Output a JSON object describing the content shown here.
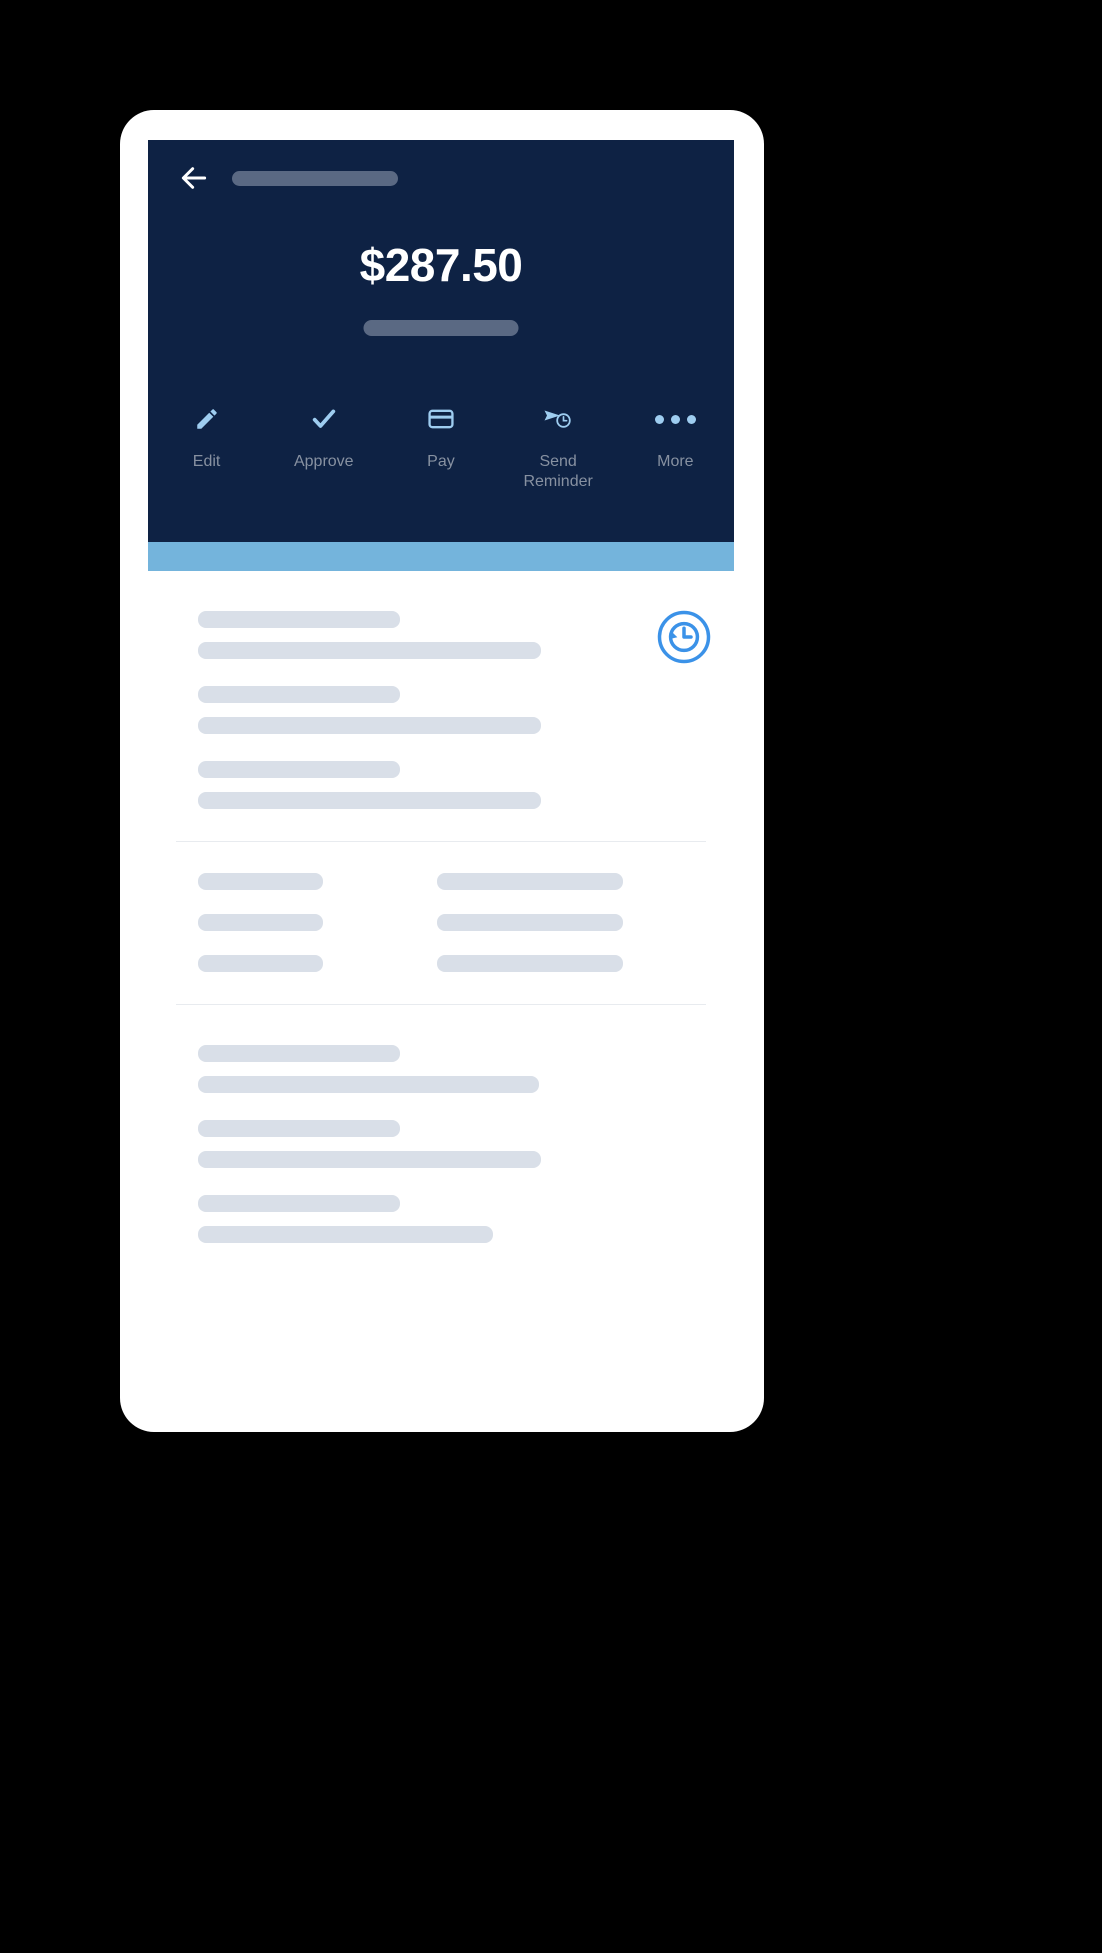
{
  "app": {
    "screen_name": "invoice-detail",
    "background_color": "#000000",
    "phone_surface_color": "#ffffff"
  },
  "header": {
    "background_color": "#0e2244",
    "back_icon": "back-arrow-icon",
    "title_placeholder": "",
    "amount": "$287.50",
    "amount_color": "#ffffff",
    "subtitle_placeholder": "",
    "placeholder_pill_color": "#5a6983"
  },
  "actions": {
    "icon_color": "#9ecdf0",
    "label_color": "#8791a1",
    "items": [
      {
        "id": "edit",
        "label": "Edit",
        "icon": "pencil-icon"
      },
      {
        "id": "approve",
        "label": "Approve",
        "icon": "check-icon"
      },
      {
        "id": "pay",
        "label": "Pay",
        "icon": "credit-card-icon"
      },
      {
        "id": "send-reminder",
        "label": "Send\nReminder",
        "icon": "send-clock-icon"
      },
      {
        "id": "more",
        "label": "More",
        "icon": "more-dots-icon"
      }
    ]
  },
  "divider_band": {
    "color": "#74b4dc"
  },
  "content": {
    "history_button": {
      "icon": "history-icon",
      "color": "#3b92e8"
    },
    "skeleton_color": "#d9dfe8",
    "rule_color": "#e8ebef",
    "section_one": {
      "rows": [
        {
          "line1_width": "short",
          "line2_width": "xlong"
        },
        {
          "line1_width": "short",
          "line2_width": "xlong"
        },
        {
          "line1_width": "short",
          "line2_width": "xlong"
        }
      ]
    },
    "section_two": {
      "rows": [
        {
          "left_width": "c-left",
          "right_width": "c-right"
        },
        {
          "left_width": "c-left",
          "right_width": "c-right"
        },
        {
          "left_width": "c-left",
          "right_width": "c-right"
        }
      ]
    },
    "section_three": {
      "rows": [
        {
          "line1_width": "short",
          "line2_width": "xxlong"
        },
        {
          "line1_width": "short",
          "line2_width": "xlong"
        },
        {
          "line1_width": "short",
          "line2_width": "long2"
        }
      ]
    }
  }
}
